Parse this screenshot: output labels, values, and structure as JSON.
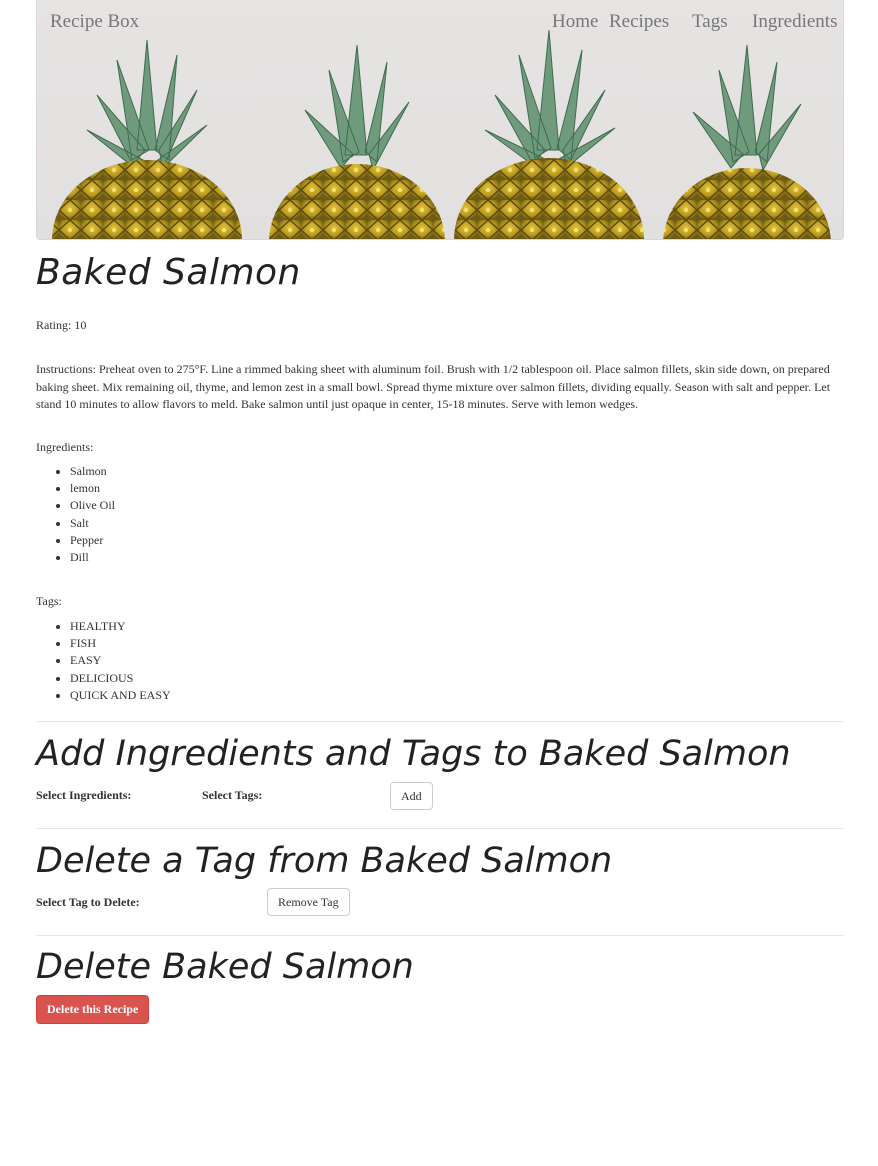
{
  "nav": {
    "brand": "Recipe Box",
    "links": [
      "Home",
      "Recipes",
      "Tags",
      "Ingredients"
    ]
  },
  "recipe": {
    "title": "Baked Salmon",
    "rating": "Rating: 10",
    "instructions": "Instructions: Preheat oven to 275°F. Line a rimmed baking sheet with aluminum foil. Brush with 1/2 tablespoon oil. Place salmon fillets, skin side down, on prepared baking sheet. Mix remaining oil, thyme, and lemon zest in a small bowl. Spread thyme mixture over salmon fillets, dividing equally. Season with salt and pepper. Let stand 10 minutes to allow flavors to meld. Bake salmon until just opaque in center, 15-18 minutes. Serve with lemon wedges.",
    "ingredients_label": "Ingredients:",
    "ingredients": [
      "Salmon",
      "lemon",
      "Olive Oil",
      "Salt",
      "Pepper",
      "Dill"
    ],
    "tags_label": "Tags:",
    "tags": [
      "HEALTHY",
      "FISH",
      "EASY",
      "DELICIOUS",
      "QUICK AND EASY"
    ]
  },
  "add_section": {
    "heading": "Add Ingredients and Tags to Baked Salmon",
    "ingredients_label": "Select Ingredients:",
    "tags_label": "Select Tags:",
    "button": "Add"
  },
  "delete_tag_section": {
    "heading": "Delete a Tag from Baked Salmon",
    "label": "Select Tag to Delete:",
    "button": "Remove Tag"
  },
  "delete_recipe_section": {
    "heading": "Delete Baked Salmon",
    "button": "Delete this Recipe"
  },
  "colors": {
    "danger": "#d9534f",
    "nav_text": "#777777"
  }
}
